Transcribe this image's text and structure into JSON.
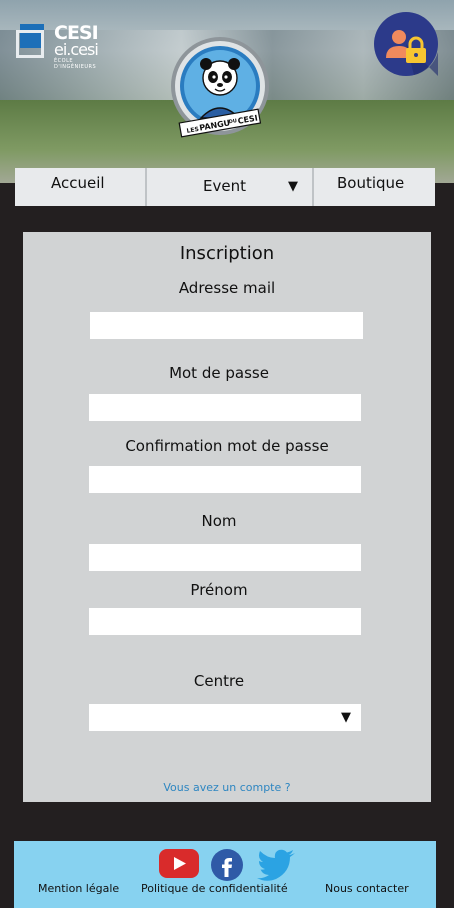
{
  "header": {
    "logo": {
      "line1": "CESI",
      "line2": "ei.cesi",
      "line3": "ÉCOLE D'INGÉNIEURS"
    },
    "badge": {
      "text_top": "LES",
      "text_main": "PANGU",
      "text_mid": "DU",
      "text_end": "CESI"
    },
    "user_icon": "user-lock-icon"
  },
  "nav": {
    "accueil": "Accueil",
    "event": "Event",
    "event_caret": "▼",
    "boutique": "Boutique"
  },
  "form": {
    "title": "Inscription",
    "email_label": "Adresse mail",
    "email_value": "",
    "password_label": "Mot de passe",
    "password_value": "",
    "confirm_label": "Confirmation mot de passe",
    "confirm_value": "",
    "nom_label": "Nom",
    "nom_value": "",
    "prenom_label": "Prénom",
    "prenom_value": "",
    "centre_label": "Centre",
    "centre_value": "",
    "centre_caret": "▼",
    "account_link": "Vous avez un compte ?"
  },
  "footer": {
    "mention": "Mention légale",
    "politique": "Politique de confidentialité",
    "contact": "Nous contacter",
    "icons": [
      "youtube-icon",
      "facebook-icon",
      "twitter-icon"
    ]
  },
  "colors": {
    "background": "#231f20",
    "panel": "#d1d3d4",
    "nav": "#e8eaec",
    "footer": "#87d2f0",
    "link": "#2e86c1",
    "user_button": "#2c3a8a"
  }
}
